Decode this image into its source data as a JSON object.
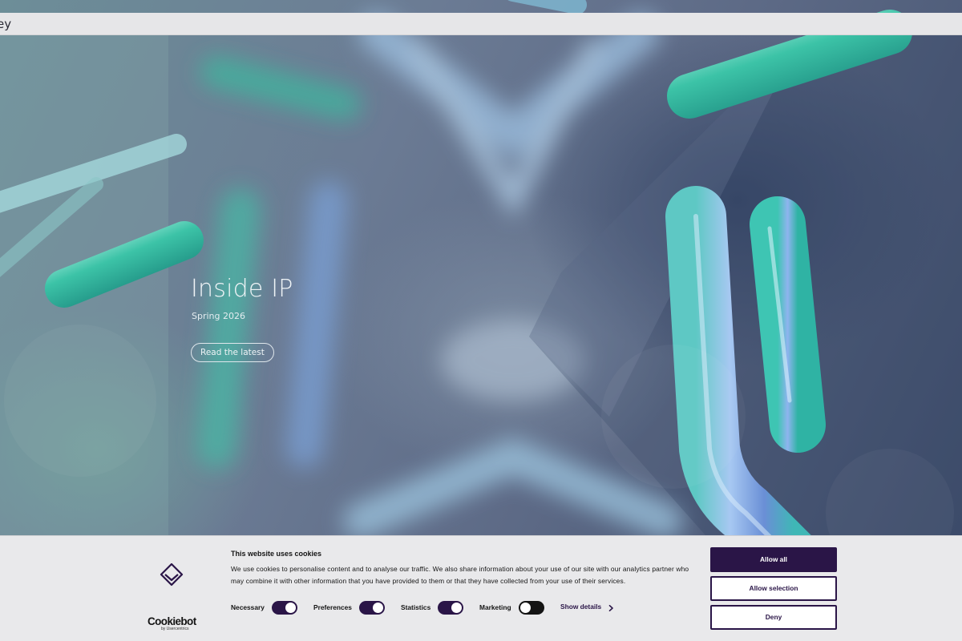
{
  "topbar": {
    "brand_fragment": "ey"
  },
  "hero": {
    "title": "Inside IP",
    "subtitle": "Spring 2026",
    "cta_label": "Read the latest"
  },
  "cookie_banner": {
    "title": "This website uses cookies",
    "body": "We use cookies to personalise content and to analyse our traffic. We also share information about your use of our site with our analytics partner who may combine it with other information that you have provided to them or that they have collected from your use of their services.",
    "logo_wordmark": "Cookiebot",
    "logo_byline": "by Usercentrics",
    "consents": [
      {
        "label": "Necessary",
        "enabled": true
      },
      {
        "label": "Preferences",
        "enabled": true
      },
      {
        "label": "Statistics",
        "enabled": true
      },
      {
        "label": "Marketing",
        "enabled": false
      }
    ],
    "show_details_label": "Show details",
    "buttons": {
      "allow_all": "Allow all",
      "allow_selection": "Allow selection",
      "deny": "Deny"
    }
  },
  "colors": {
    "accent": "#2a1547",
    "banner_bg": "#e9e9eb",
    "topbar_bg": "#e6e6e8",
    "glass_teal": "#39c3a8",
    "glass_blue": "#7fa7d9"
  },
  "icons": {
    "logo_mark": "diamond-chevron-icon",
    "show_details": "chevron-right-icon"
  }
}
